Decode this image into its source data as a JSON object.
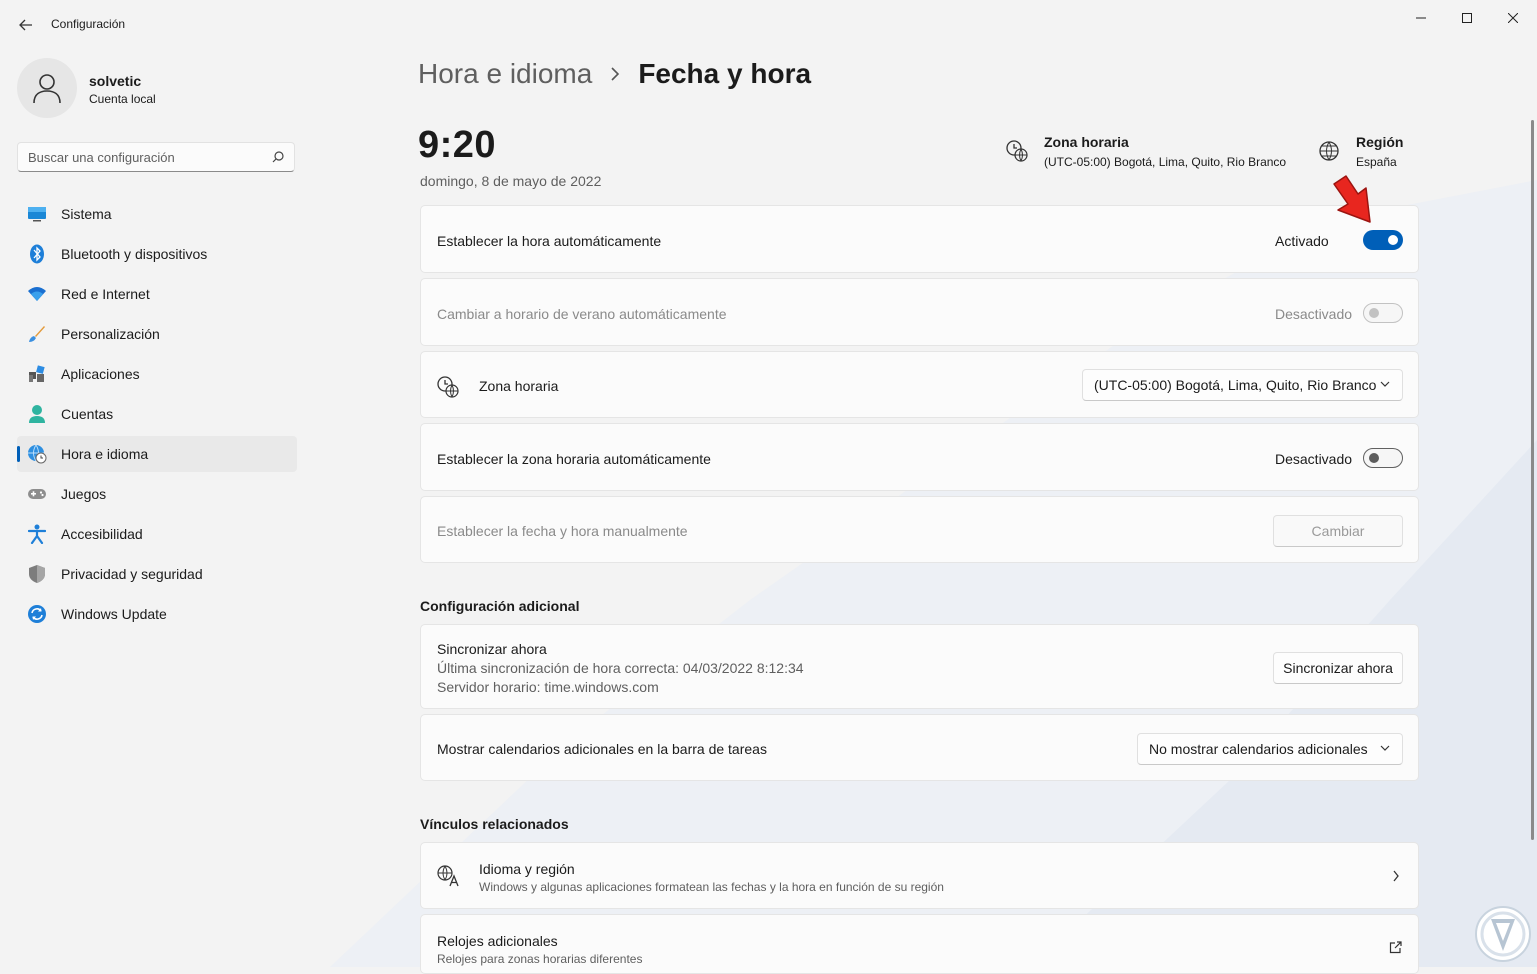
{
  "window": {
    "title": "Configuración"
  },
  "profile": {
    "name": "solvetic",
    "account_type": "Cuenta local"
  },
  "search": {
    "placeholder": "Buscar una configuración"
  },
  "sidebar": {
    "items": [
      {
        "label": "Sistema",
        "icon": "monitor-icon",
        "active": false
      },
      {
        "label": "Bluetooth y dispositivos",
        "icon": "bluetooth-icon",
        "active": false
      },
      {
        "label": "Red e Internet",
        "icon": "wifi-icon",
        "active": false
      },
      {
        "label": "Personalización",
        "icon": "brush-icon",
        "active": false
      },
      {
        "label": "Aplicaciones",
        "icon": "apps-icon",
        "active": false
      },
      {
        "label": "Cuentas",
        "icon": "person-icon",
        "active": false
      },
      {
        "label": "Hora e idioma",
        "icon": "globe-clock-icon",
        "active": true
      },
      {
        "label": "Juegos",
        "icon": "gamepad-icon",
        "active": false
      },
      {
        "label": "Accesibilidad",
        "icon": "accessibility-icon",
        "active": false
      },
      {
        "label": "Privacidad y seguridad",
        "icon": "shield-icon",
        "active": false
      },
      {
        "label": "Windows Update",
        "icon": "update-icon",
        "active": false
      }
    ]
  },
  "breadcrumb": {
    "parent": "Hora e idioma",
    "current": "Fecha y hora"
  },
  "clock": {
    "time": "9:20",
    "date": "domingo, 8 de mayo de 2022"
  },
  "header_info": {
    "timezone_title": "Zona horaria",
    "timezone_value": "(UTC-05:00) Bogotá, Lima, Quito, Rio Branco",
    "region_title": "Región",
    "region_value": "España"
  },
  "settings": {
    "auto_time": {
      "label": "Establecer la hora automáticamente",
      "state": "Activado",
      "on": true
    },
    "dst": {
      "label": "Cambiar a horario de verano automáticamente",
      "state": "Desactivado",
      "on": false,
      "disabled": true
    },
    "timezone": {
      "label": "Zona horaria",
      "value": "(UTC-05:00) Bogotá, Lima, Quito, Rio Branco"
    },
    "auto_timezone": {
      "label": "Establecer la zona horaria automáticamente",
      "state": "Desactivado",
      "on": false
    },
    "manual": {
      "label": "Establecer la fecha y hora manualmente",
      "button": "Cambiar",
      "disabled": true
    }
  },
  "additional": {
    "title": "Configuración adicional",
    "sync": {
      "title": "Sincronizar ahora",
      "last_sync": "Última sincronización de hora correcta: 04/03/2022 8:12:34",
      "server": "Servidor horario: time.windows.com",
      "button": "Sincronizar ahora"
    },
    "calendars": {
      "label": "Mostrar calendarios adicionales en la barra de tareas",
      "value": "No mostrar calendarios adicionales"
    }
  },
  "related": {
    "title": "Vínculos relacionados",
    "language": {
      "title": "Idioma y región",
      "subtitle": "Windows y algunas aplicaciones formatean las fechas y la hora en función de su región"
    },
    "clocks": {
      "title": "Relojes adicionales",
      "subtitle": "Relojes para zonas horarias diferentes"
    }
  },
  "colors": {
    "accent": "#005fb8",
    "annotation_arrow": "#e8261f"
  }
}
